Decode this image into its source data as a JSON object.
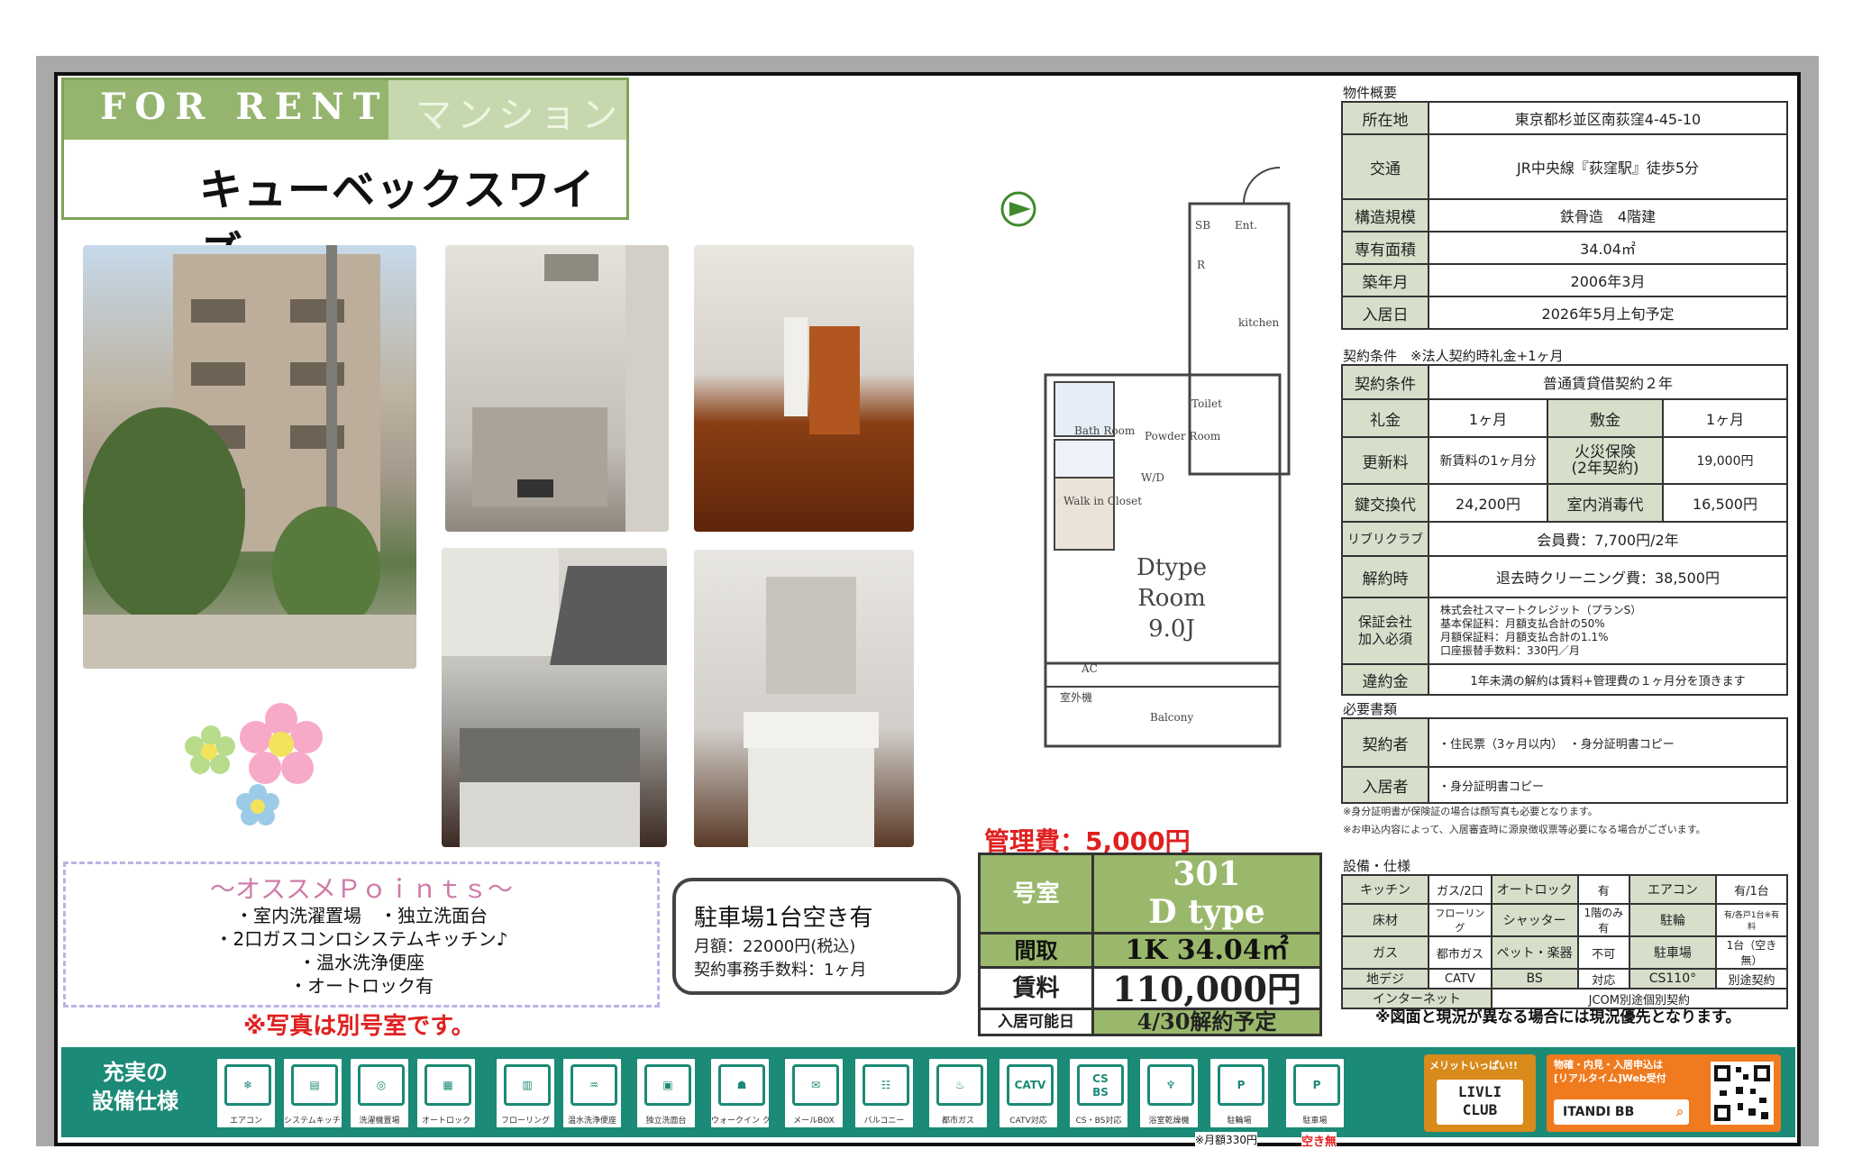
{
  "header": {
    "for_rent": "FOR RENT",
    "type": "マンション",
    "name": "キューベックスワイズ"
  },
  "overview": {
    "heading": "物件概要",
    "rows": [
      {
        "label": "所在地",
        "value": "東京都杉並区南荻窪4-45-10"
      },
      {
        "label": "交通",
        "value": "JR中央線『荻窪駅』徒歩5分"
      },
      {
        "label": "構造規模",
        "value": "鉄骨造　4階建"
      },
      {
        "label": "専有面積",
        "value": "34.04㎡"
      },
      {
        "label": "築年月",
        "value": "2006年3月"
      },
      {
        "label": "入居日",
        "value": "2026年5月上旬予定"
      }
    ]
  },
  "contract": {
    "heading": "契約条件　※法人契約時礼金+1ヶ月",
    "type_label": "契約条件",
    "type_value": "普通賃貸借契約２年",
    "reikin_label": "礼金",
    "reikin_value": "1ヶ月",
    "shikikin_label": "敷金",
    "shikikin_value": "1ヶ月",
    "renew_label": "更新料",
    "renew_value": "新賃料の1ヶ月分",
    "fire_label": "火災保険\n(2年契約)",
    "fire_value": "19,000円",
    "key_label": "鍵交換代",
    "key_value": "24,200円",
    "disinfect_label": "室内消毒代",
    "disinfect_value": "16,500円",
    "club_label": "リブリクラブ",
    "club_value": "会員費：7,700円/2年",
    "cancel_label": "解約時",
    "cancel_value": "退去時クリーニング費：38,500円",
    "guar_label": "保証会社\n加入必須",
    "guar_lines": [
      "株式会社スマートクレジット（プランS）",
      "基本保証料：月額支払合計の50%",
      "月額保証料：月額支払合計の1.1%",
      "口座振替手数料：330円／月"
    ],
    "penalty_label": "違約金",
    "penalty_value": "1年未満の解約は賃料+管理費の１ヶ月分を頂きます"
  },
  "docs": {
    "heading": "必要書類",
    "signer_label": "契約者",
    "signer_value": "・住民票（3ヶ月以内）　・身分証明書コピー",
    "resident_label": "入居者",
    "resident_value": "・身分証明書コピー",
    "note1": "※身分証明書が保険証の場合は顔写真も必要となります。",
    "note2": "※お申込内容によって、入居審査時に源泉徴収票等必要になる場合がございます。"
  },
  "equipment": {
    "heading": "設備・仕様",
    "rows": [
      [
        "キッチン",
        "ガス/2口",
        "オートロック",
        "有",
        "エアコン",
        "有/1台"
      ],
      [
        "床材",
        "フローリング",
        "シャッター",
        "1階のみ有",
        "駐輪",
        "有/各戸1台※有料"
      ],
      [
        "ガス",
        "都市ガス",
        "ペット・楽器",
        "不可",
        "駐車場",
        "1台（空き無）"
      ],
      [
        "地デジ",
        "CATV",
        "BS",
        "対応",
        "CS110°",
        "別途契約"
      ]
    ],
    "internet_label": "インターネット",
    "internet_value": "JCOM別途個別契約",
    "diff_note": "※図面と現況が異なる場合には現況優先となります。"
  },
  "floorplan": {
    "type": "Dtype",
    "room": "Room",
    "size": "9.0J",
    "entrance": "Ent.",
    "sb": "SB",
    "r": "R",
    "kitchen": "kitchen",
    "toilet": "Toilet",
    "bath": "Bath\nRoom",
    "powder": "Powder\nRoom",
    "wd": "W/D",
    "closet": "Walk in\nCloset",
    "ac": "AC",
    "outdoor": "室外機",
    "balcony": "Balcony"
  },
  "rent": {
    "mgmt": "管理費：5,000円",
    "room_label": "号室",
    "room_no": "301",
    "room_type": "D type",
    "layout_label": "間取",
    "layout_value": "1K 34.04㎡",
    "rent_label": "賃料",
    "rent_value": "110,000円",
    "move_label": "入居可能日",
    "move_value": "4/30解約予定"
  },
  "points": {
    "title": "〜オススメＰｏｉｎｔｓ〜",
    "items": [
      "・室内洗濯置場　・独立洗面台",
      "・2口ガスコンロシステムキッチン♪",
      "・温水洗浄便座",
      "・オートロック有"
    ]
  },
  "photo_note": "※写真は別号室です。",
  "parking": {
    "title": "駐車場1台空き有",
    "line1": "月額：22000円(税込)",
    "line2": "契約事務手数料：1ヶ月"
  },
  "features": {
    "title": "充実の\n設備仕様",
    "items": [
      "エアコン",
      "システムキッチン 2口ガス",
      "洗濯機置場",
      "オートロック",
      "フローリング",
      "温水洗浄便座",
      "独立洗面台",
      "ウォークイン クローゼット",
      "メールBOX",
      "バルコニー",
      "都市ガス",
      "CATV対応",
      "CS・BS対応",
      "浴室乾燥機",
      "駐輪場",
      "駐車場"
    ],
    "catv_label": "CATV",
    "cs_label": "CS\nBS",
    "bike_note": "※月額330円",
    "car_note": "空き無"
  },
  "ads": {
    "livli_top": "メリットいっぱい!!",
    "livli": "LIVLI\nCLUB",
    "itandi_top": "物確・内見・入居申込は\n[リアルタイム]Web受付",
    "itandi": "ITANDI BB"
  },
  "colors": {
    "accent": "#95b56f",
    "label_bg": "#d7dfcb",
    "rent_green": "#9ab86b",
    "bar": "#1b8a76",
    "red": "#e02020"
  }
}
